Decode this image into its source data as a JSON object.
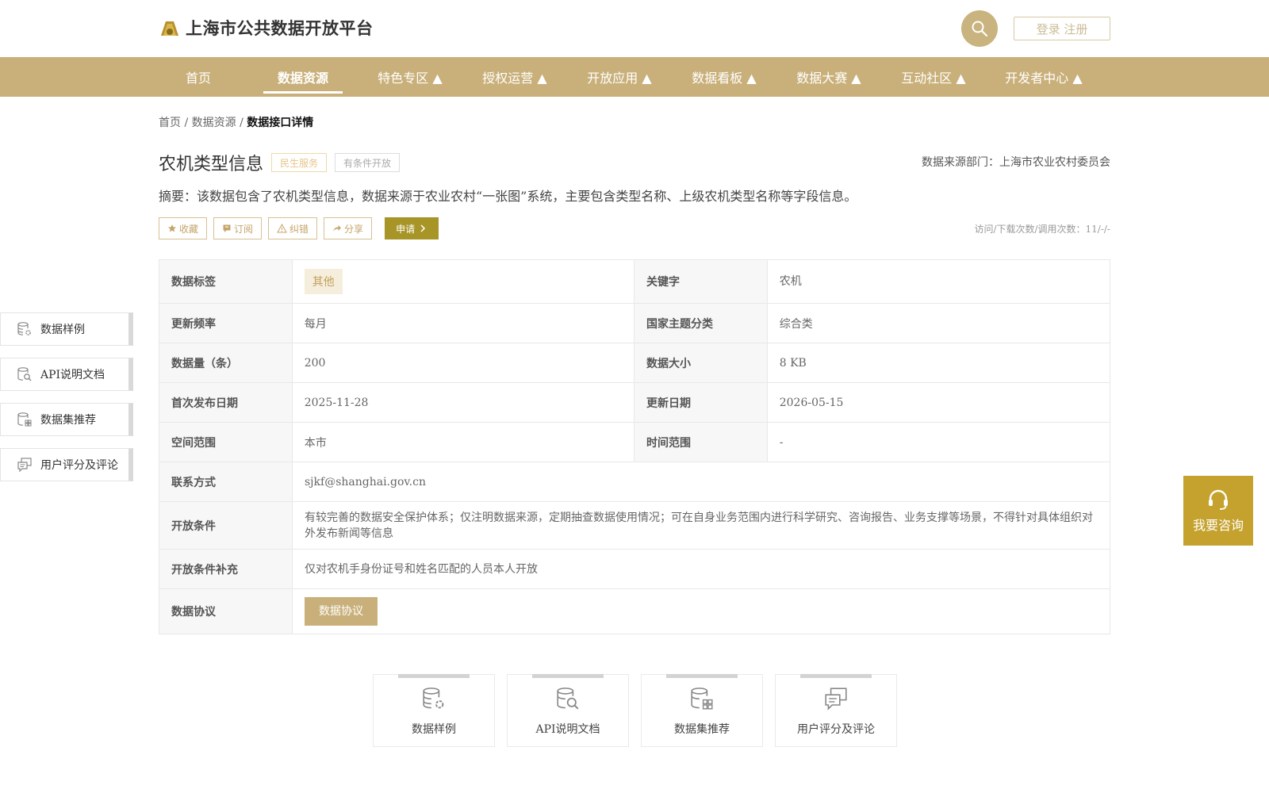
{
  "header": {
    "title": "上海市公共数据开放平台",
    "login_label": "登录 注册"
  },
  "nav": {
    "items": [
      {
        "label": "首页"
      },
      {
        "label": "数据资源",
        "active": true
      },
      {
        "label": "特色专区 ▲"
      },
      {
        "label": "授权运营 ▲"
      },
      {
        "label": "开放应用 ▲"
      },
      {
        "label": "数据看板 ▲"
      },
      {
        "label": "数据大赛 ▲"
      },
      {
        "label": "互动社区 ▲"
      },
      {
        "label": "开发者中心 ▲"
      }
    ]
  },
  "breadcrumb": {
    "home": "首页",
    "sep": " / ",
    "parent": "数据资源",
    "current": "数据接口详情"
  },
  "detail": {
    "title": "农机类型信息",
    "badge_1": "民生服务",
    "badge_2": "有条件开放",
    "source": "数据来源部门：上海市农业农村委员会",
    "summary": "摘要：该数据包含了农机类型信息，数据来源于农业农村“一张图”系统，主要包含类型名称、上级农机类型名称等字段信息。",
    "visits": "访问/下载次数/调用次数：11/-/-"
  },
  "actions": {
    "favorite": "收藏",
    "subscribe": "订阅",
    "correct": "纠错",
    "share": "分享",
    "apply": "申请"
  },
  "table": {
    "tag_label": "数据标签",
    "tag_value": "其他",
    "keyword_label": "关键字",
    "keyword_value": "农机",
    "freq_label": "更新频率",
    "freq_value": "每月",
    "theme_label": "国家主题分类",
    "theme_value": "综合类",
    "count_label": "数据量（条）",
    "count_value": "200",
    "size_label": "数据大小",
    "size_value": "8 KB",
    "first_label": "首次发布日期",
    "first_value": "2025-11-28",
    "update_label": "更新日期",
    "update_value": "2026-05-15",
    "space_label": "空间范围",
    "space_value": "本市",
    "time_label": "时间范围",
    "time_value": "-",
    "contact_label": "联系方式",
    "contact_value": "sjkf@shanghai.gov.cn",
    "cond_label": "开放条件",
    "cond_value": "有较完善的数据安全保护体系；仅注明数据来源，定期抽查数据使用情况；可在自身业务范围内进行科学研究、咨询报告、业务支撑等场景，不得针对具体组织对外发布新闻等信息",
    "cond_extra_label": "开放条件补充",
    "cond_extra_value": "仅对农机手身份证号和姓名匹配的人员本人开放",
    "agreement_label": "数据协议",
    "agreement_button": "数据协议"
  },
  "side_nav": {
    "items": [
      {
        "label": "数据样例",
        "icon": "database-gear-icon"
      },
      {
        "label": "API说明文档",
        "icon": "document-search-icon"
      },
      {
        "label": "数据集推荐",
        "icon": "database-grid-icon"
      },
      {
        "label": "用户评分及评论",
        "icon": "comment-icon"
      }
    ]
  },
  "cards": {
    "items": [
      {
        "label": "数据样例",
        "icon": "database-gear-icon"
      },
      {
        "label": "API说明文档",
        "icon": "document-search-icon"
      },
      {
        "label": "数据集推荐",
        "icon": "database-grid-icon"
      },
      {
        "label": "用户评分及评论",
        "icon": "comment-icon"
      }
    ]
  },
  "consult": {
    "label": "我要咨询",
    "icon": "headset-icon"
  },
  "colors": {
    "brand": "#c9b07a",
    "apply": "#a89528",
    "consult": "#c5a22e"
  }
}
